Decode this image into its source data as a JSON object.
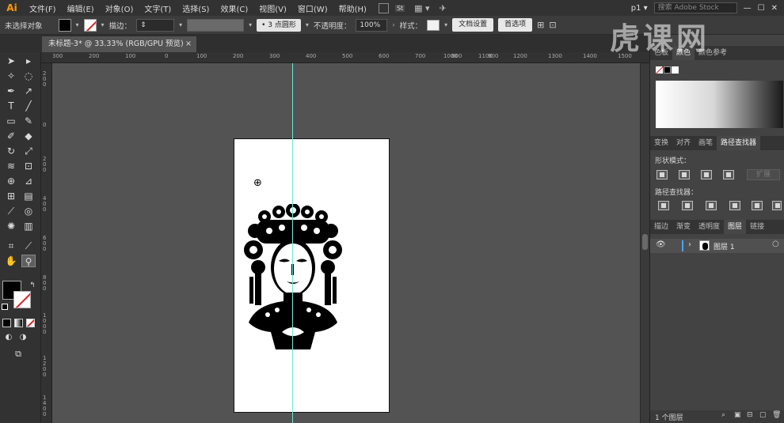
{
  "app": {
    "logo": "Ai",
    "menu": [
      "文件(F)",
      "编辑(E)",
      "对象(O)",
      "文字(T)",
      "选择(S)",
      "效果(C)",
      "视图(V)",
      "窗口(W)",
      "帮助(H)"
    ],
    "badge_st": "St",
    "workspace": "p1",
    "search_placeholder": "搜索 Adobe Stock"
  },
  "control_bar": {
    "selection_state": "未选择对象",
    "stroke_label": "描边：",
    "brush_label": "3 点圆形",
    "opacity_label": "不透明度：",
    "opacity_value": "100%",
    "style_label": "样式：",
    "doc_setup_button": "文档设置",
    "preferences_button": "首选项"
  },
  "document": {
    "tab_title": "未标题-3* @ 33.33% (RGB/GPU 预览)",
    "close_glyph": "×"
  },
  "rulers": {
    "top": [
      "300",
      "200",
      "100",
      "0",
      "100",
      "200",
      "300",
      "400",
      "500",
      "600",
      "700",
      "800",
      "900",
      "1000",
      "1100",
      "1200",
      "1300",
      "1400",
      "1500"
    ],
    "left": [
      "200",
      "0",
      "200",
      "400",
      "600",
      "800",
      "1000",
      "1200",
      "1400"
    ]
  },
  "panels": {
    "color_tabs": [
      "色板",
      "颜色",
      "颜色参考"
    ],
    "pathfinder_tabs": [
      "变换",
      "对齐",
      "画笔",
      "路径查找器"
    ],
    "shape_modes_label": "形状模式：",
    "expand_button": "扩展",
    "pathfinder_label": "路径查找器：",
    "layer_tabs": [
      "描边",
      "渐变",
      "透明度",
      "图层",
      "链接"
    ],
    "layer_name": "图层 1",
    "layer_count": "1 个图层"
  },
  "watermark": "虎课网"
}
